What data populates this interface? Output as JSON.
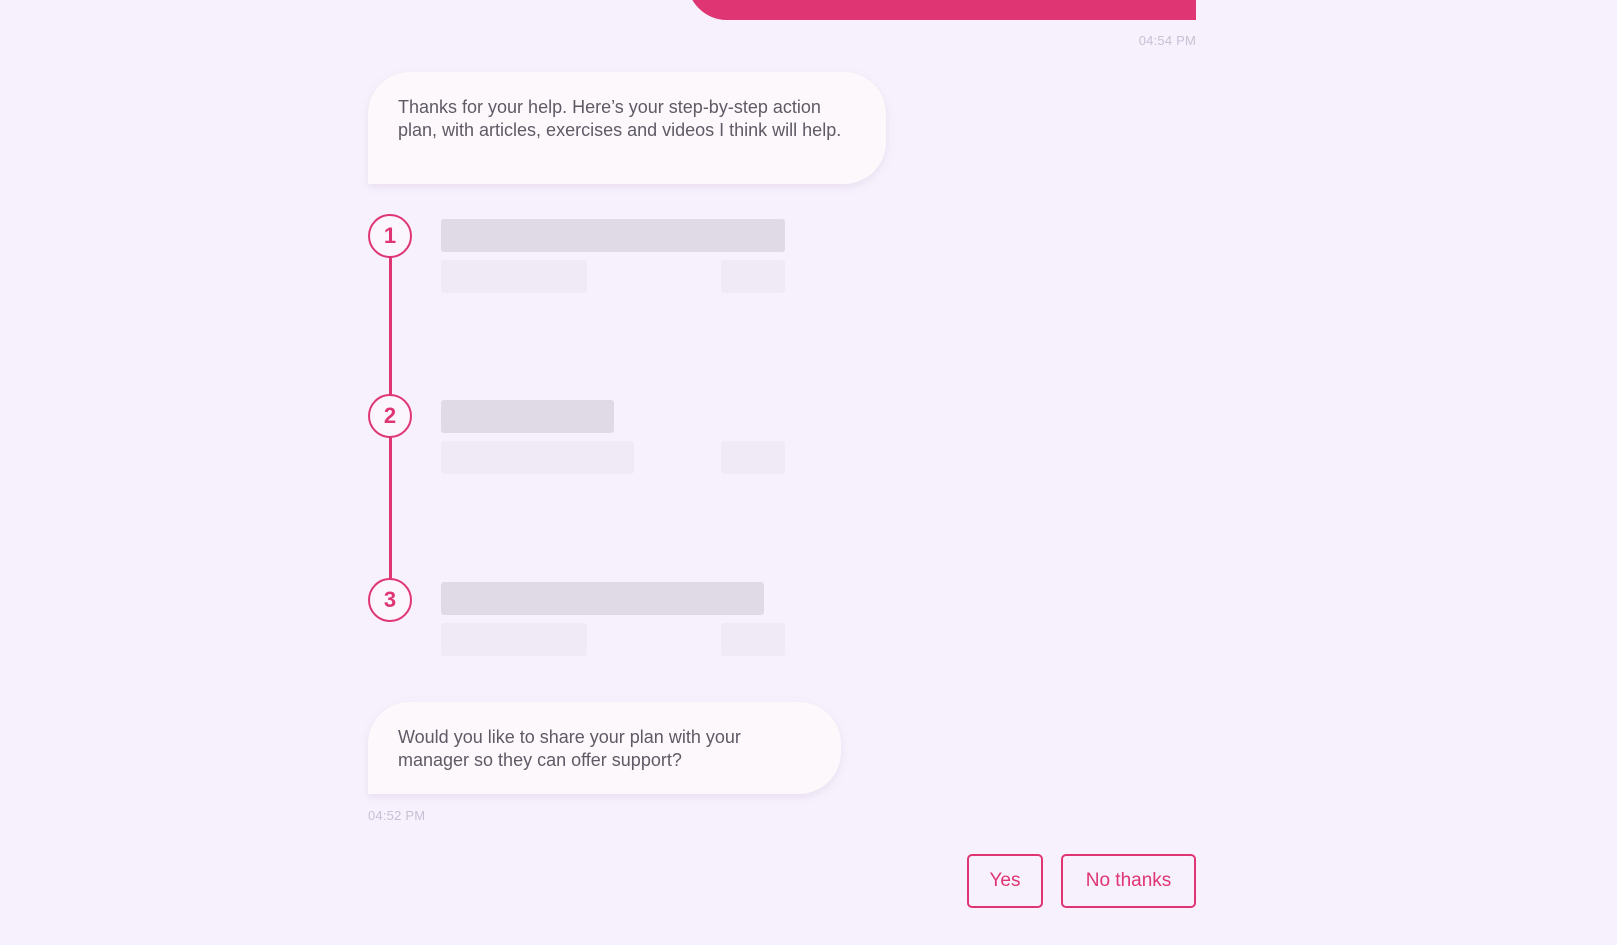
{
  "chat": {
    "messages": [
      {
        "sender": "user",
        "time": "04:54 PM"
      },
      {
        "sender": "bot",
        "text": "Thanks for your help. Here’s your step-by-step action plan, with articles, exercises and videos I think will help."
      },
      {
        "sender": "bot",
        "text": "Would you like to share your plan with your manager so they can offer support?",
        "time": "04:52 PM"
      }
    ],
    "plan_steps": [
      {
        "number": "1"
      },
      {
        "number": "2"
      },
      {
        "number": "3"
      }
    ],
    "quick_replies": {
      "yes": "Yes",
      "no": "No thanks"
    }
  },
  "colors": {
    "accent": "#df3573",
    "background": "#f7f1fd",
    "bubble": "#fdf8fb",
    "skeleton_title": "#e0d9e6",
    "skeleton_sub": "#efeaf6"
  }
}
